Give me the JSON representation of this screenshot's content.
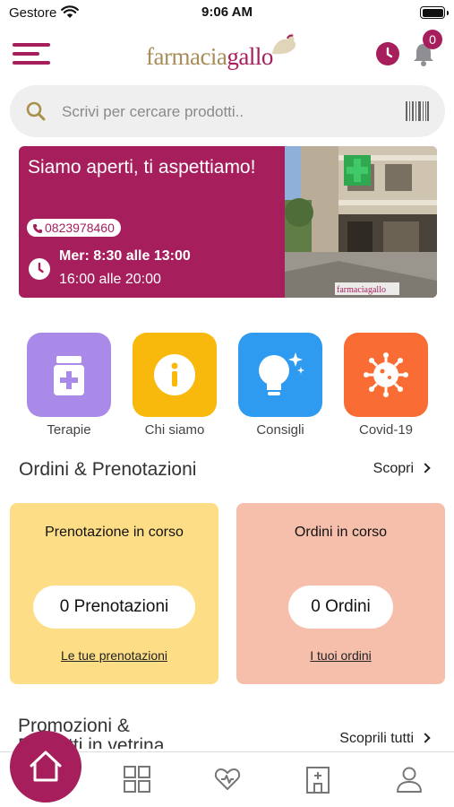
{
  "status_bar": {
    "carrier": "Gestore",
    "time": "9:06 AM"
  },
  "header": {
    "logo_part1": "farmacia",
    "logo_part2": "gallo",
    "notifications_count": "0"
  },
  "search": {
    "placeholder": "Scrivi per cercare prodotti.."
  },
  "banner": {
    "title": "Siamo aperti, ti aspettiamo!",
    "phone": "0823978460",
    "hours_line1": "Mer: 8:30 alle 13:00",
    "hours_line2": "16:00 alle 20:00",
    "photo_caption": "farmaciagallo"
  },
  "categories": [
    {
      "label": "Terapie",
      "color": "#a98ae8",
      "icon": "medicine-jar-icon"
    },
    {
      "label": "Chi siamo",
      "color": "#f9b90c",
      "icon": "info-icon"
    },
    {
      "label": "Consigli",
      "color": "#2f9bf0",
      "icon": "lightbulb-icon"
    },
    {
      "label": "Covid-19",
      "color": "#f96c34",
      "icon": "virus-icon"
    }
  ],
  "orders_section": {
    "title": "Ordini & Prenotazioni",
    "link": "Scopri",
    "cards": [
      {
        "title": "Prenotazione in corso",
        "value": "0 Prenotazioni",
        "link": "Le tue prenotazioni",
        "color": "#fdde86"
      },
      {
        "title": "Ordini in corso",
        "value": "0 Ordini",
        "link": "I tuoi ordini",
        "color": "#f6bfac"
      }
    ]
  },
  "promo_section": {
    "title_line1": "Promozioni &",
    "title_line2": "Prodotti in vetrina",
    "link": "Scoprili tutti"
  },
  "bottom_nav": [
    "home-icon",
    "grid-icon",
    "heart-care-icon",
    "pharmacy-icon",
    "profile-icon"
  ],
  "colors": {
    "brand": "#a61f5c",
    "logo_gold": "#a78d5a"
  }
}
